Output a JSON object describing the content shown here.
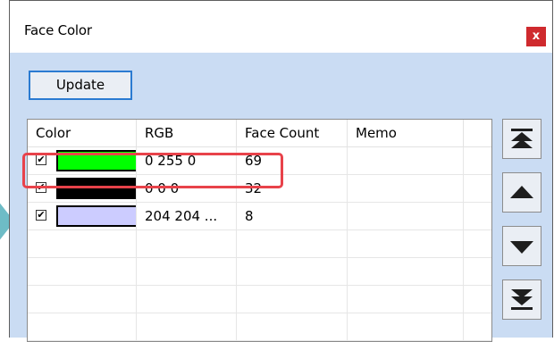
{
  "window": {
    "title": "Face Color",
    "close_label": "x"
  },
  "toolbar": {
    "update_label": "Update"
  },
  "table": {
    "headers": [
      "Color",
      "RGB",
      "Face Count",
      "Memo"
    ],
    "rows": [
      {
        "checked": true,
        "swatch": "#00ff00",
        "rgb": "0 255 0",
        "count": "69",
        "memo": ""
      },
      {
        "checked": true,
        "swatch": "#000000",
        "rgb": "0 0 0",
        "count": "32",
        "memo": ""
      },
      {
        "checked": true,
        "swatch": "#ccccff",
        "rgb": "204 204 ...",
        "count": "8",
        "memo": ""
      }
    ],
    "check_mark": "✔"
  },
  "side_buttons": [
    {
      "icon": "move-to-top-icon"
    },
    {
      "icon": "move-up-icon"
    },
    {
      "icon": "move-down-icon"
    },
    {
      "icon": "move-to-bottom-icon"
    }
  ],
  "colors": {
    "client_bg": "#cadcf3",
    "close_bg": "#cf2a2e",
    "highlight": "#e8424a",
    "button_border": "#2b7bd1"
  }
}
